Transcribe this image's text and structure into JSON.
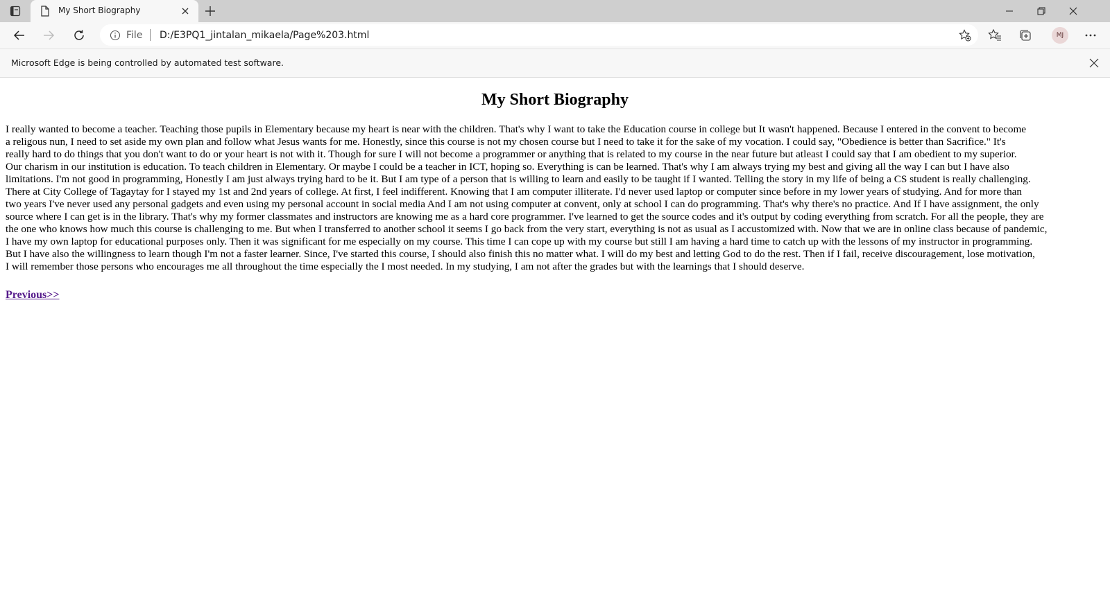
{
  "browser": {
    "tab": {
      "title": "My Short Biography"
    },
    "address": {
      "scheme_label": "File",
      "url": "D:/E3PQ1_jintalan_mikaela/Page%203.html"
    },
    "profile_initials": "MJ",
    "infobar": {
      "message": "Microsoft Edge is being controlled by automated test software."
    }
  },
  "page": {
    "title": "My Short Biography",
    "paragraph_lines": [
      "I really wanted to become a teacher. Teaching those pupils in Elementary because my heart is near with the children. That's why I want to take the Education course in college but It wasn't happened. Because I entered in the convent to become",
      "a religous nun, I need to set aside my own plan and follow what Jesus wants for me. Honestly, since this course is not my chosen course but I need to take it for the sake of my vocation. I could say, \"Obedience is better than Sacrifice.\" It's",
      "really hard to do things that you don't want to do or your heart is not with it. Though for sure I will not become a programmer or anything that is related to my course in the near future but atleast I could say that I am obedient to my superior.",
      "Our charism in our institution is education. To teach children in Elementary. Or maybe I could be a teacher in ICT, hoping so. Everything is can be learned. That's why I am always trying my best and giving all the way I can but I have also",
      "limitations. I'm not good in programming, Honestly I am just always trying hard to be it. But I am type of a person that is willing to learn and easily to be taught if I wanted. Telling the story in my life of being a CS student is really challenging.",
      "There at City College of Tagaytay for I stayed my 1st and 2nd years of college. At first, I feel indifferent. Knowing that I am computer illiterate. I'd never used laptop or computer since before in my lower years of studying. And for more than",
      "two years I've never used any personal gadgets and even using my personal account in social media And I am not using computer at convent, only at school I can do programming. That's why there's no practice. And If I have assignment, the only",
      "source where I can get is in the library. That's why my former classmates and instructors are knowing me as a hard core programmer. I've learned to get the source codes and it's output by coding everything from scratch. For all the people, they are",
      "the one who knows how much this course is challenging to me. But when I transferred to another school it seems I go back from the very start, everything is not as usual as I accustomized with. Now that we are in online class because of pandemic,",
      "I have my own laptop for educational purposes only. Then it was significant for me especially on my course. This time I can cope up with my course but still I am having a hard time to catch up with the lessons of my instructor in programming.",
      "But I have also the willingness to learn though I'm not a faster learner. Since, I've started this course, I should also finish this no matter what. I will do my best and letting God to do the rest. Then if I fail, receive discouragement, lose motivation,",
      "I will remember those persons who encourages me all throughout the time especially the I most needed. In my studying, I am not after the grades but with the learnings that I should deserve."
    ],
    "previous_link": "Previous>>"
  },
  "colors": {
    "tabstrip": "#cfcfcf",
    "toolbar": "#f7f7f7",
    "visited_link": "#551a8b"
  }
}
